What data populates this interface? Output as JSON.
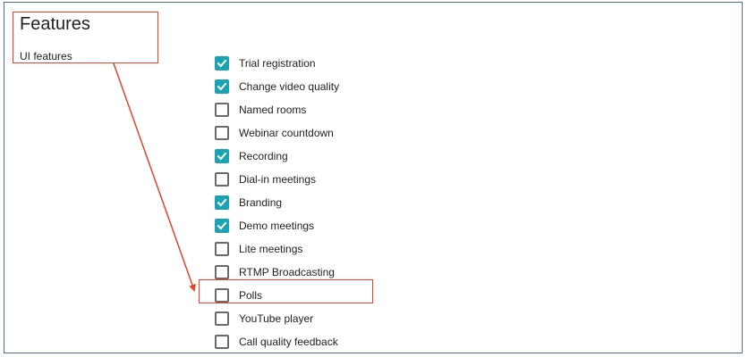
{
  "section": {
    "title": "Features",
    "subtitle": "UI features"
  },
  "colors": {
    "accent": "#1aa3b3",
    "annotation": "#e5422b",
    "frame_border": "#4a6fa5"
  },
  "features": [
    {
      "label": "Trial registration",
      "checked": true
    },
    {
      "label": "Change video quality",
      "checked": true
    },
    {
      "label": "Named rooms",
      "checked": false
    },
    {
      "label": "Webinar countdown",
      "checked": false
    },
    {
      "label": "Recording",
      "checked": true
    },
    {
      "label": "Dial-in meetings",
      "checked": false
    },
    {
      "label": "Branding",
      "checked": true
    },
    {
      "label": "Demo meetings",
      "checked": true
    },
    {
      "label": "Lite meetings",
      "checked": false
    },
    {
      "label": "RTMP Broadcasting",
      "checked": false
    },
    {
      "label": "Polls",
      "checked": false,
      "highlighted": true
    },
    {
      "label": "YouTube player",
      "checked": false
    },
    {
      "label": "Call quality feedback",
      "checked": false
    }
  ]
}
